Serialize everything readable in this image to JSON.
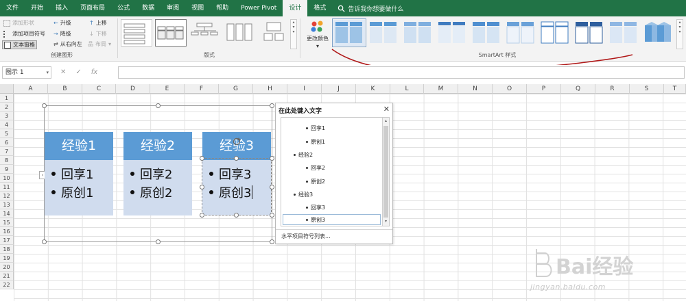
{
  "tabs": [
    "文件",
    "开始",
    "插入",
    "页面布局",
    "公式",
    "数据",
    "审阅",
    "视图",
    "帮助",
    "Power Pivot",
    "设计",
    "格式"
  ],
  "active_tab_index": 10,
  "tell_me": "告诉我你想要做什么",
  "create_graphic": {
    "label": "创建图形",
    "add_shape": "添加形状",
    "add_bullet": "添加项目符号",
    "text_pane": "文本窗格",
    "promote": "升级",
    "demote": "降级",
    "right_to_left": "从右向左",
    "move_up": "上移",
    "move_down": "下移",
    "layout": "布局"
  },
  "layouts_label": "版式",
  "change_colors": "更改颜色",
  "smartart_styles_label": "SmartArt 样式",
  "formula_bar": {
    "name_box": "图示 1",
    "fx": "fx"
  },
  "columns": [
    "A",
    "B",
    "C",
    "D",
    "E",
    "F",
    "G",
    "H",
    "I",
    "J",
    "K",
    "L",
    "M",
    "N",
    "O",
    "P",
    "Q",
    "R",
    "S",
    "T"
  ],
  "rows": [
    "1",
    "2",
    "3",
    "4",
    "5",
    "6",
    "7",
    "8",
    "9",
    "10",
    "11",
    "12",
    "13",
    "14",
    "15",
    "16",
    "17",
    "18",
    "19",
    "20",
    "21",
    "22"
  ],
  "smartart": {
    "blocks": [
      {
        "title": "经验1",
        "items": [
          "回享1",
          "原创1"
        ]
      },
      {
        "title": "经验2",
        "items": [
          "回享2",
          "原创2"
        ]
      },
      {
        "title": "经验3",
        "items": [
          "回享3",
          "原创3"
        ]
      }
    ],
    "fill_head": "#5b9bd5",
    "fill_body": "#d0dcee"
  },
  "text_pane": {
    "title": "在此处键入文字",
    "items": [
      {
        "level": 2,
        "text": "回享1"
      },
      {
        "level": 2,
        "text": "原创1"
      },
      {
        "level": 1,
        "text": "经验2"
      },
      {
        "level": 2,
        "text": "回享2"
      },
      {
        "level": 2,
        "text": "原创2"
      },
      {
        "level": 1,
        "text": "经验3"
      },
      {
        "level": 2,
        "text": "回享3"
      },
      {
        "level": 2,
        "text": "原创3"
      }
    ],
    "footer": "水平项目符号列表..."
  },
  "watermark": {
    "brand": "Bai经验",
    "url": "jingyan.baidu.com"
  },
  "colors": {
    "excel_green": "#217346",
    "annotation_red": "#b01818"
  }
}
